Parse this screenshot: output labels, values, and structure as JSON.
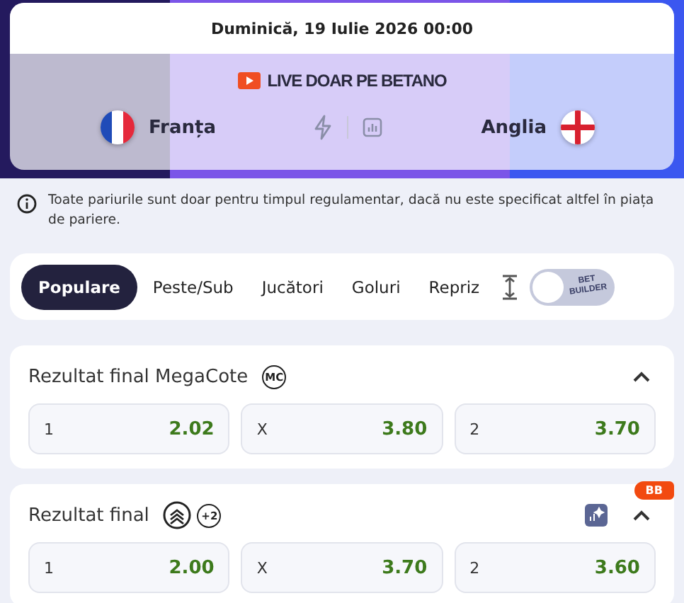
{
  "event": {
    "date": "Duminică, 19 Iulie 2026 00:00",
    "live_label": "LIVE DOAR PE BETANO",
    "home": {
      "name": "Franța",
      "kind": "tricolor"
    },
    "away": {
      "name": "Anglia",
      "kind": "cross"
    }
  },
  "notice": "Toate pariurile sunt doar pentru timpul regulamentar, dacă nu este specificat altfel în piața de pariere.",
  "tabs": [
    {
      "label": "Populare",
      "selected": true
    },
    {
      "label": "Peste/Sub",
      "selected": false
    },
    {
      "label": "Jucători",
      "selected": false
    },
    {
      "label": "Goluri",
      "selected": false
    },
    {
      "label": "Repriz",
      "selected": false
    }
  ],
  "bet_builder": {
    "label": "BET BUILDER",
    "on": false
  },
  "markets": [
    {
      "title": "Rezultat final MegaCote",
      "badges": [
        "MC"
      ],
      "stats_badge": false,
      "expanded": true,
      "outcomes": [
        {
          "label": "1",
          "odds": "2.02"
        },
        {
          "label": "X",
          "odds": "3.80"
        },
        {
          "label": "2",
          "odds": "3.70"
        }
      ]
    },
    {
      "title": "Rezultat final",
      "boost_icon": true,
      "badges": [
        "+2"
      ],
      "stats_badge": true,
      "corner_badge": "BB",
      "expanded": true,
      "outcomes": [
        {
          "label": "1",
          "odds": "2.00"
        },
        {
          "label": "X",
          "odds": "3.70"
        },
        {
          "label": "2",
          "odds": "3.60"
        }
      ]
    }
  ]
}
